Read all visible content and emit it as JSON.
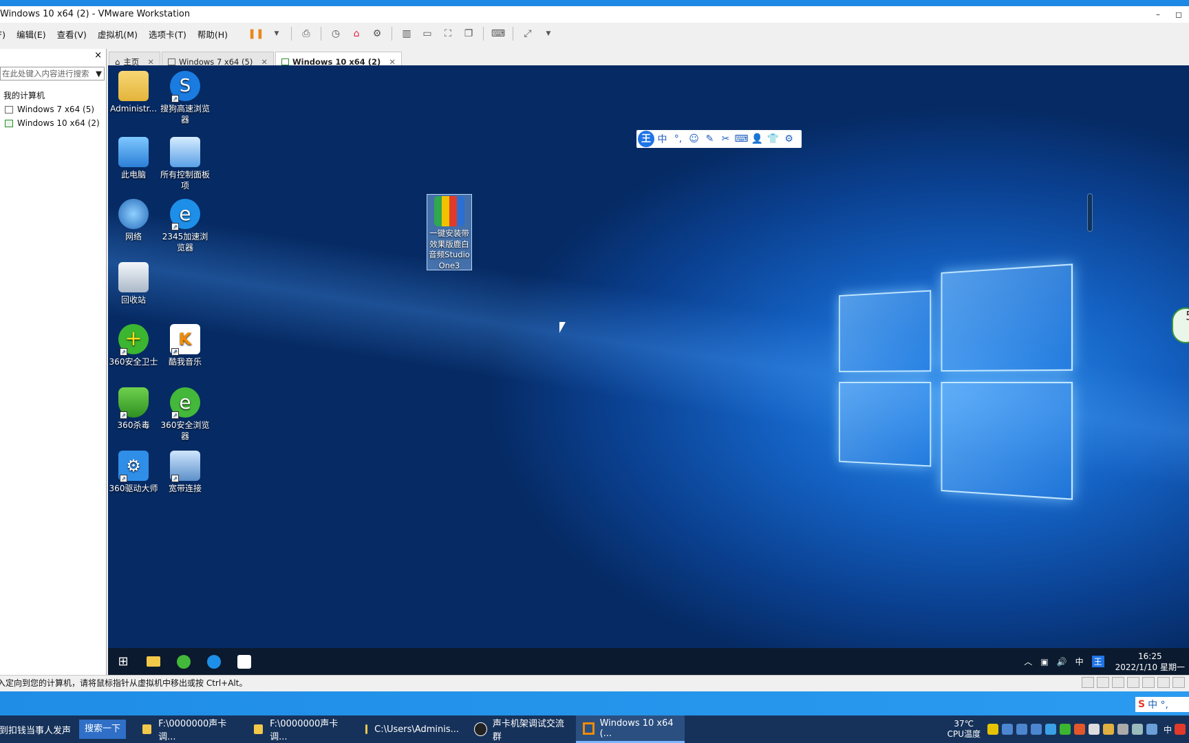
{
  "window": {
    "title": "Windows 10 x64 (2) - VMware Workstation",
    "controls": [
      "–",
      "◻"
    ]
  },
  "menu": {
    "items": [
      "文件(F)",
      "编辑(E)",
      "查看(V)",
      "虚拟机(M)",
      "选项卡(T)",
      "帮助(H)"
    ]
  },
  "library": {
    "close": "×",
    "search_placeholder": "在此处键入内容进行搜索",
    "root": "我的计算机",
    "vms": [
      "Windows 7 x64 (5)",
      "Windows 10 x64 (2)"
    ]
  },
  "tabs": [
    {
      "label": "主页",
      "active": false
    },
    {
      "label": "Windows 7 x64 (5)",
      "active": false
    },
    {
      "label": "Windows 10 x64 (2)",
      "active": true
    }
  ],
  "desktop": {
    "icons": [
      {
        "label": "Administr..."
      },
      {
        "label": "搜狗高速浏览器"
      },
      {
        "label": "此电脑"
      },
      {
        "label": "所有控制面板项"
      },
      {
        "label": "网络"
      },
      {
        "label": "2345加速浏览器"
      },
      {
        "label": "回收站"
      },
      {
        "label": "360安全卫士"
      },
      {
        "label": "酷我音乐"
      },
      {
        "label": "360杀毒"
      },
      {
        "label": "360安全浏览器"
      },
      {
        "label": "360驱动大师"
      },
      {
        "label": "宽带连接"
      },
      {
        "label": "一键安装带效果版鹿白音频Studio One3"
      }
    ],
    "ime_toolbar": [
      "王",
      "中",
      "°,",
      "☺",
      "✎",
      "✂",
      "⌨",
      "👤",
      "👕",
      "⚙"
    ],
    "speed_widget": "5"
  },
  "guest_taskbar": {
    "tray_lang": "中",
    "time": "16:25",
    "date": "2022/1/10 星期一"
  },
  "vm_status": {
    "text": "要将输入定向到您的计算机，请将鼠标指针从虚拟机中移出或按 Ctrl+Alt。"
  },
  "host_taskbar": {
    "input_text": "提到扣钱当事人发声",
    "search_button": "搜索一下",
    "items": [
      {
        "label": "F:\\0000000声卡调...",
        "active": false
      },
      {
        "label": "F:\\0000000声卡调...",
        "active": false
      },
      {
        "label": "C:\\Users\\Adminis...",
        "active": false
      },
      {
        "label": "声卡机架调试交流群",
        "active": false
      },
      {
        "label": "Windows 10 x64 (...",
        "active": true
      }
    ],
    "temperature": "37℃",
    "temp_label": "CPU温度",
    "tray_lang": "中",
    "sogou": "中 °,"
  }
}
